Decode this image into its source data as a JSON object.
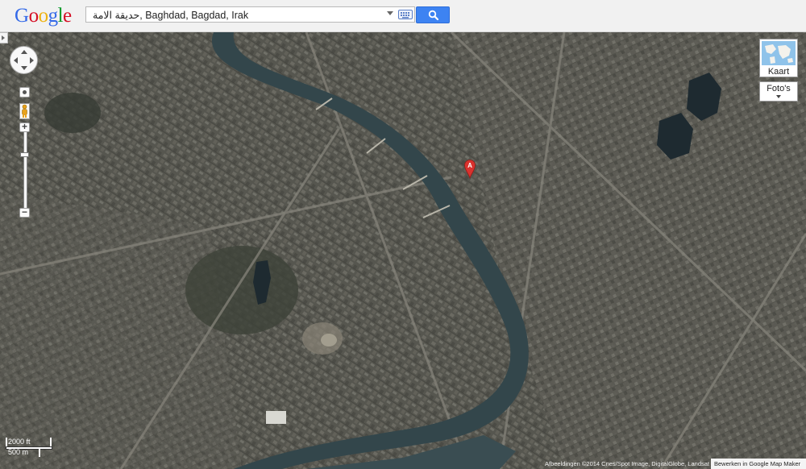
{
  "header": {
    "logo_letters": [
      {
        "ch": "G",
        "color": "#3369e8"
      },
      {
        "ch": "o",
        "color": "#d50f25"
      },
      {
        "ch": "o",
        "color": "#eeb211"
      },
      {
        "ch": "g",
        "color": "#3369e8"
      },
      {
        "ch": "l",
        "color": "#009925"
      },
      {
        "ch": "e",
        "color": "#d50f25"
      }
    ],
    "search": {
      "value": "حديقة الامة, Baghdad, Bagdad, Irak"
    }
  },
  "map": {
    "marker_label": "A",
    "maptype": {
      "kaart_label": "Kaart",
      "fotos_label": "Foto's"
    },
    "scale": {
      "imperial": "2000 ft",
      "metric": "500 m"
    },
    "attribution": "Afbeeldingen ©2014 Cnes/Spot Image, DigitalGlobe, Landsat",
    "mapmaker_link": "Bewerken in Google Map Maker"
  },
  "colors": {
    "accent": "#3d83f2",
    "river": "#34474c",
    "marker": "#d9322e"
  }
}
